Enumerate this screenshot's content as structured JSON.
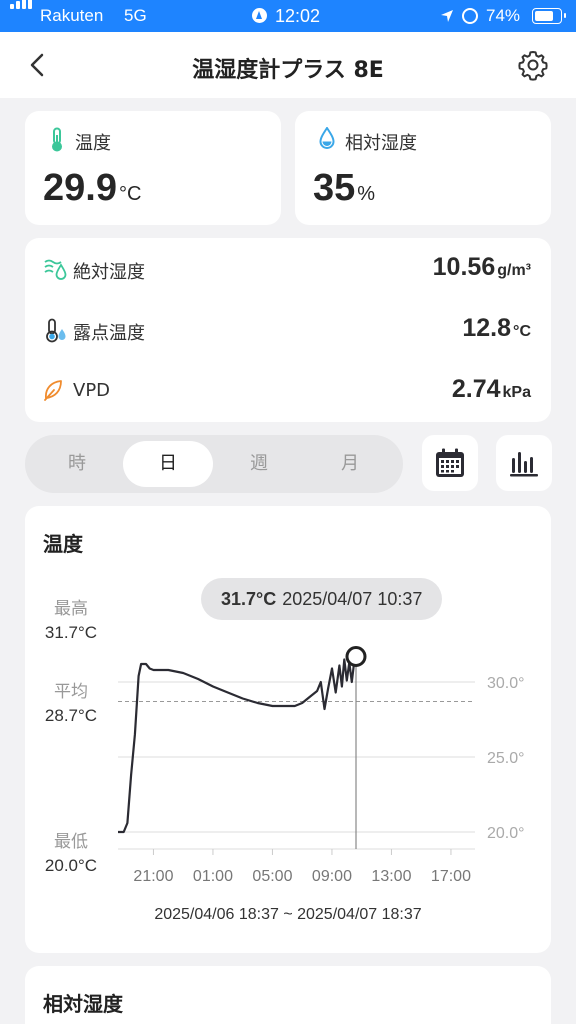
{
  "status_bar": {
    "carrier": "Rakuten",
    "network": "5G",
    "time": "12:02",
    "battery": "74%",
    "battery_level": 0.74
  },
  "nav": {
    "title": "温湿度計プラス 8E"
  },
  "temperature_card": {
    "label": "温度",
    "value": "29.9",
    "unit": "°C"
  },
  "humidity_card": {
    "label": "相対湿度",
    "value": "35",
    "unit": "%"
  },
  "metrics": [
    {
      "label": "絶対湿度",
      "value": "10.56",
      "unit": "g/m³",
      "icon": "absolute-humidity-icon"
    },
    {
      "label": "露点温度",
      "value": "12.8",
      "unit": "°C",
      "icon": "dew-point-icon"
    },
    {
      "label": "VPD",
      "value": "2.74",
      "unit": "kPa",
      "icon": "leaf-icon"
    }
  ],
  "period_tabs": {
    "items": [
      "時",
      "日",
      "週",
      "月"
    ],
    "selected": "日"
  },
  "toolbar": {
    "calendar_icon": "calendar-icon",
    "chart_icon": "bar-chart-icon"
  },
  "colors": {
    "accent": "#1e84ff",
    "line": "#2b2b33",
    "temp_icon": "#3cc79a",
    "humidity_icon": "#3aa7e8",
    "vpd_icon": "#f08c2e"
  },
  "chart": {
    "title": "温度",
    "tooltip": {
      "value": "31.7°C",
      "time": "2025/04/07 10:37"
    },
    "stats": {
      "max_label": "最高",
      "max": "31.7°C",
      "avg_label": "平均",
      "avg": "28.7°C",
      "min_label": "最低",
      "min": "20.0°C"
    },
    "range": "2025/04/06 18:37 ~ 2025/04/07 18:37"
  },
  "chart_data": {
    "type": "line",
    "title": "温度",
    "xlabel": "",
    "ylabel": "",
    "x_ticks": [
      "21:00",
      "01:00",
      "05:00",
      "09:00",
      "13:00",
      "17:00"
    ],
    "y_ticks": [
      "20.0°",
      "25.0°",
      "30.0°"
    ],
    "ylim": [
      20,
      30.0
    ],
    "average": 28.7,
    "series": [
      {
        "x": [
          "18:37",
          "19:00",
          "19:15",
          "19:30",
          "19:45",
          "20:00",
          "20:10",
          "20:20",
          "20:30",
          "20:45",
          "21:00",
          "22:00",
          "23:00",
          "00:00",
          "01:00",
          "02:00",
          "03:00",
          "04:00",
          "05:00",
          "06:00",
          "06:30",
          "07:00",
          "07:30",
          "08:00",
          "08:15",
          "08:30",
          "08:45",
          "09:00",
          "09:15",
          "09:30",
          "09:40",
          "09:50",
          "10:00",
          "10:10",
          "10:20",
          "10:30",
          "10:37"
        ],
        "values": [
          20.0,
          20.0,
          20.6,
          23.8,
          26.5,
          30.4,
          31.2,
          31.2,
          31.2,
          30.9,
          30.8,
          30.8,
          30.6,
          30.2,
          29.7,
          29.3,
          28.9,
          28.6,
          28.4,
          28.4,
          28.4,
          28.6,
          29.0,
          29.4,
          30.0,
          28.2,
          29.6,
          30.9,
          29.3,
          31.1,
          29.7,
          31.5,
          30.1,
          31.3,
          30.0,
          31.4,
          31.7
        ]
      }
    ],
    "cursor": {
      "x": "10:37",
      "value": 31.7
    }
  }
}
